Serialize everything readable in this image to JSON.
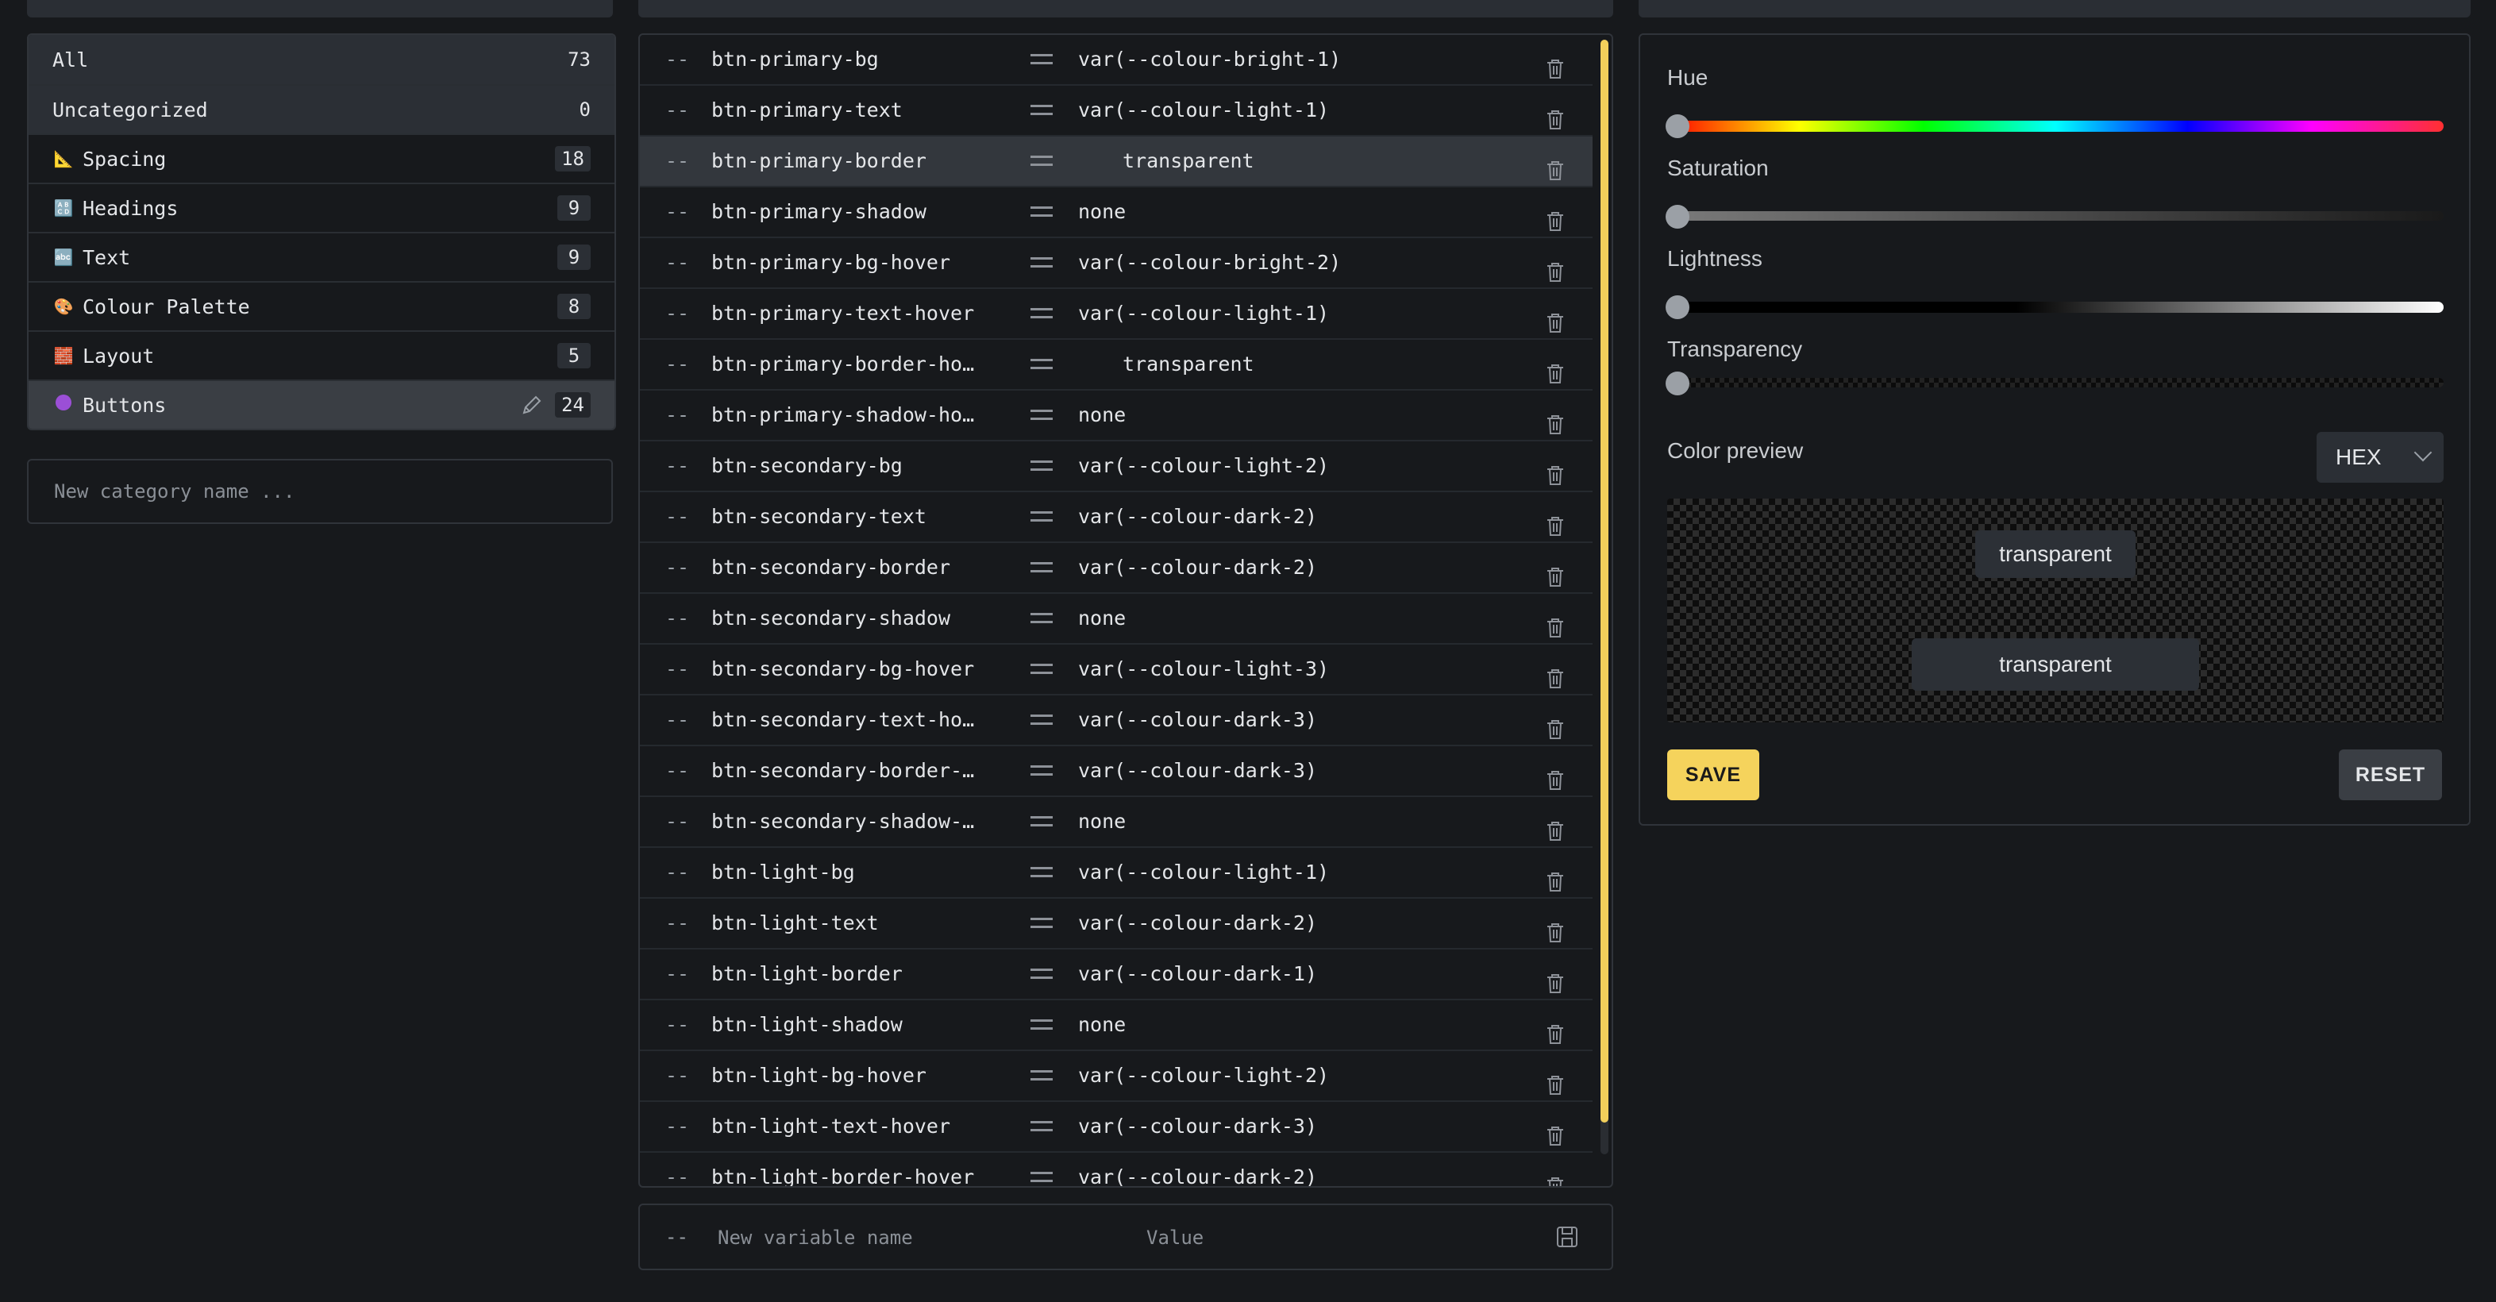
{
  "categories": [
    {
      "label": "All",
      "count": "73",
      "icon": ""
    },
    {
      "label": "Uncategorized",
      "count": "0",
      "icon": ""
    },
    {
      "label": "Spacing",
      "count": "18",
      "icon": "triangle-ruler-icon"
    },
    {
      "label": "Headings",
      "count": "9",
      "icon": "abcd-icon"
    },
    {
      "label": "Text",
      "count": "9",
      "icon": "abc-icon"
    },
    {
      "label": "Colour Palette",
      "count": "8",
      "icon": "palette-icon"
    },
    {
      "label": "Layout",
      "count": "5",
      "icon": "bricks-icon"
    },
    {
      "label": "Buttons",
      "count": "24",
      "icon": "purple-circle-icon"
    }
  ],
  "new_category_placeholder": "New category name ...",
  "variables": [
    {
      "prefix": "--",
      "name": "btn-primary-bg",
      "value": "var(--colour-bright-1)"
    },
    {
      "prefix": "--",
      "name": "btn-primary-text",
      "value": "var(--colour-light-1)"
    },
    {
      "prefix": "--",
      "name": "btn-primary-border",
      "value": "transparent"
    },
    {
      "prefix": "--",
      "name": "btn-primary-shadow",
      "value": "none"
    },
    {
      "prefix": "--",
      "name": "btn-primary-bg-hover",
      "value": "var(--colour-bright-2)"
    },
    {
      "prefix": "--",
      "name": "btn-primary-text-hover",
      "value": "var(--colour-light-1)"
    },
    {
      "prefix": "--",
      "name": "btn-primary-border-hov…",
      "value": "transparent"
    },
    {
      "prefix": "--",
      "name": "btn-primary-shadow-hov…",
      "value": "none"
    },
    {
      "prefix": "--",
      "name": "btn-secondary-bg",
      "value": "var(--colour-light-2)"
    },
    {
      "prefix": "--",
      "name": "btn-secondary-text",
      "value": "var(--colour-dark-2)"
    },
    {
      "prefix": "--",
      "name": "btn-secondary-border",
      "value": "var(--colour-dark-2)"
    },
    {
      "prefix": "--",
      "name": "btn-secondary-shadow",
      "value": "none"
    },
    {
      "prefix": "--",
      "name": "btn-secondary-bg-hover",
      "value": "var(--colour-light-3)"
    },
    {
      "prefix": "--",
      "name": "btn-secondary-text-hov…",
      "value": "var(--colour-dark-3)"
    },
    {
      "prefix": "--",
      "name": "btn-secondary-border-h…",
      "value": "var(--colour-dark-3)"
    },
    {
      "prefix": "--",
      "name": "btn-secondary-shadow-h…",
      "value": "none"
    },
    {
      "prefix": "--",
      "name": "btn-light-bg",
      "value": "var(--colour-light-1)"
    },
    {
      "prefix": "--",
      "name": "btn-light-text",
      "value": "var(--colour-dark-2)"
    },
    {
      "prefix": "--",
      "name": "btn-light-border",
      "value": "var(--colour-dark-1)"
    },
    {
      "prefix": "--",
      "name": "btn-light-shadow",
      "value": "none"
    },
    {
      "prefix": "--",
      "name": "btn-light-bg-hover",
      "value": "var(--colour-light-2)"
    },
    {
      "prefix": "--",
      "name": "btn-light-text-hover",
      "value": "var(--colour-dark-3)"
    },
    {
      "prefix": "--",
      "name": "btn-light-border-hover",
      "value": "var(--colour-dark-2)"
    }
  ],
  "new_variable": {
    "prefix": "--",
    "name_placeholder": "New variable name",
    "value_placeholder": "Value"
  },
  "picker": {
    "hue_label": "Hue",
    "saturation_label": "Saturation",
    "lightness_label": "Lightness",
    "transparency_label": "Transparency",
    "preview_label": "Color preview",
    "format": "HEX",
    "preview_text_1": "transparent",
    "preview_text_2": "transparent",
    "save_label": "SAVE",
    "reset_label": "RESET"
  },
  "colors": {
    "accent": "#f5d35c",
    "background": "#17191c",
    "panel_border": "#30343a"
  }
}
